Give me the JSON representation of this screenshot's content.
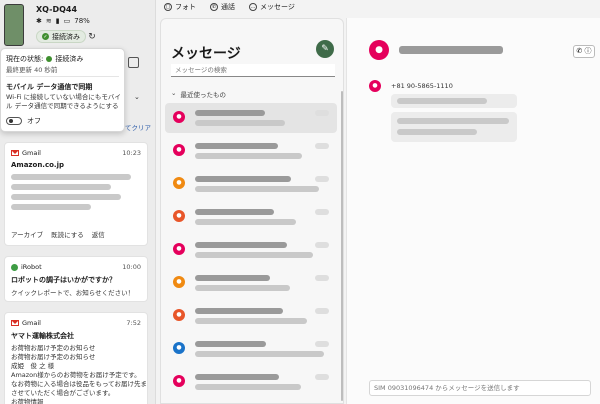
{
  "device": {
    "name": "XQ-DQ44",
    "battery": "78%",
    "status_pill": "接続済み"
  },
  "popup": {
    "status_label": "現在の状態:",
    "status_value": "接続済み",
    "last_update": "最終更新 40 秒前",
    "sync_title": "モバイル データ通信で同期",
    "sync_desc": "Wi-Fi に接続していない場合にもモバイル データ通信で同期できるようにする",
    "toggle_label": "オフ"
  },
  "left": {
    "clear_label": "てクリア",
    "notifications": [
      {
        "app": "Gmail",
        "time": "10:23",
        "title": "Amazon.co.jp",
        "actions": [
          "アーカイブ",
          "既読にする",
          "返信"
        ]
      },
      {
        "app": "iRobot",
        "time": "10:00",
        "title": "ロボットの調子はいかがですか？",
        "line1": "クイックレポートで、お知らせください！"
      },
      {
        "app": "Gmail",
        "time": "7:52",
        "title": "ヤマト運輸株式会社",
        "lines": [
          "お荷物お届け予定のお知らせ",
          "お荷物お届け予定のお知らせ",
          "成姫　俊 之 様",
          "Amazon様からのお荷物をお届け予定です。",
          "なお荷物に入る場合は役品をもってお届け先ま",
          "させていただく場合がございます。",
          "お荷物情報"
        ]
      }
    ]
  },
  "nav": {
    "photos": "フォト",
    "calls": "通話",
    "messages": "メッセージ"
  },
  "messages": {
    "title": "メッセージ",
    "search_placeholder": "メッセージの検索",
    "recent_label": "最近使ったもの",
    "conversations": [
      {
        "color": "#e5005c"
      },
      {
        "color": "#e5005c"
      },
      {
        "color": "#f08a12"
      },
      {
        "color": "#e8562a"
      },
      {
        "color": "#e5005c"
      },
      {
        "color": "#f08a12"
      },
      {
        "color": "#e8562a"
      },
      {
        "color": "#1a73c9"
      },
      {
        "color": "#e5005c"
      }
    ]
  },
  "conversation": {
    "sender_number": "+81 90-5865-1110",
    "compose_placeholder": "SIM 09031096474 からメッセージを送信します"
  }
}
